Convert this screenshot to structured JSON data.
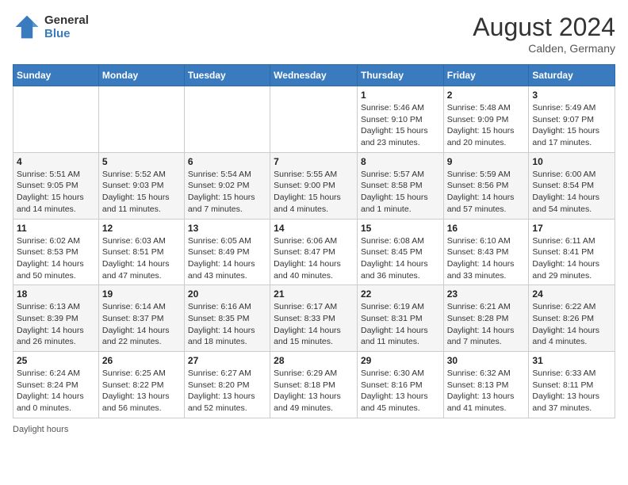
{
  "header": {
    "logo_general": "General",
    "logo_blue": "Blue",
    "month_year": "August 2024",
    "location": "Calden, Germany"
  },
  "days_of_week": [
    "Sunday",
    "Monday",
    "Tuesday",
    "Wednesday",
    "Thursday",
    "Friday",
    "Saturday"
  ],
  "weeks": [
    [
      {
        "day": "",
        "info": ""
      },
      {
        "day": "",
        "info": ""
      },
      {
        "day": "",
        "info": ""
      },
      {
        "day": "",
        "info": ""
      },
      {
        "day": "1",
        "info": "Sunrise: 5:46 AM\nSunset: 9:10 PM\nDaylight: 15 hours\nand 23 minutes."
      },
      {
        "day": "2",
        "info": "Sunrise: 5:48 AM\nSunset: 9:09 PM\nDaylight: 15 hours\nand 20 minutes."
      },
      {
        "day": "3",
        "info": "Sunrise: 5:49 AM\nSunset: 9:07 PM\nDaylight: 15 hours\nand 17 minutes."
      }
    ],
    [
      {
        "day": "4",
        "info": "Sunrise: 5:51 AM\nSunset: 9:05 PM\nDaylight: 15 hours\nand 14 minutes."
      },
      {
        "day": "5",
        "info": "Sunrise: 5:52 AM\nSunset: 9:03 PM\nDaylight: 15 hours\nand 11 minutes."
      },
      {
        "day": "6",
        "info": "Sunrise: 5:54 AM\nSunset: 9:02 PM\nDaylight: 15 hours\nand 7 minutes."
      },
      {
        "day": "7",
        "info": "Sunrise: 5:55 AM\nSunset: 9:00 PM\nDaylight: 15 hours\nand 4 minutes."
      },
      {
        "day": "8",
        "info": "Sunrise: 5:57 AM\nSunset: 8:58 PM\nDaylight: 15 hours\nand 1 minute."
      },
      {
        "day": "9",
        "info": "Sunrise: 5:59 AM\nSunset: 8:56 PM\nDaylight: 14 hours\nand 57 minutes."
      },
      {
        "day": "10",
        "info": "Sunrise: 6:00 AM\nSunset: 8:54 PM\nDaylight: 14 hours\nand 54 minutes."
      }
    ],
    [
      {
        "day": "11",
        "info": "Sunrise: 6:02 AM\nSunset: 8:53 PM\nDaylight: 14 hours\nand 50 minutes."
      },
      {
        "day": "12",
        "info": "Sunrise: 6:03 AM\nSunset: 8:51 PM\nDaylight: 14 hours\nand 47 minutes."
      },
      {
        "day": "13",
        "info": "Sunrise: 6:05 AM\nSunset: 8:49 PM\nDaylight: 14 hours\nand 43 minutes."
      },
      {
        "day": "14",
        "info": "Sunrise: 6:06 AM\nSunset: 8:47 PM\nDaylight: 14 hours\nand 40 minutes."
      },
      {
        "day": "15",
        "info": "Sunrise: 6:08 AM\nSunset: 8:45 PM\nDaylight: 14 hours\nand 36 minutes."
      },
      {
        "day": "16",
        "info": "Sunrise: 6:10 AM\nSunset: 8:43 PM\nDaylight: 14 hours\nand 33 minutes."
      },
      {
        "day": "17",
        "info": "Sunrise: 6:11 AM\nSunset: 8:41 PM\nDaylight: 14 hours\nand 29 minutes."
      }
    ],
    [
      {
        "day": "18",
        "info": "Sunrise: 6:13 AM\nSunset: 8:39 PM\nDaylight: 14 hours\nand 26 minutes."
      },
      {
        "day": "19",
        "info": "Sunrise: 6:14 AM\nSunset: 8:37 PM\nDaylight: 14 hours\nand 22 minutes."
      },
      {
        "day": "20",
        "info": "Sunrise: 6:16 AM\nSunset: 8:35 PM\nDaylight: 14 hours\nand 18 minutes."
      },
      {
        "day": "21",
        "info": "Sunrise: 6:17 AM\nSunset: 8:33 PM\nDaylight: 14 hours\nand 15 minutes."
      },
      {
        "day": "22",
        "info": "Sunrise: 6:19 AM\nSunset: 8:31 PM\nDaylight: 14 hours\nand 11 minutes."
      },
      {
        "day": "23",
        "info": "Sunrise: 6:21 AM\nSunset: 8:28 PM\nDaylight: 14 hours\nand 7 minutes."
      },
      {
        "day": "24",
        "info": "Sunrise: 6:22 AM\nSunset: 8:26 PM\nDaylight: 14 hours\nand 4 minutes."
      }
    ],
    [
      {
        "day": "25",
        "info": "Sunrise: 6:24 AM\nSunset: 8:24 PM\nDaylight: 14 hours\nand 0 minutes."
      },
      {
        "day": "26",
        "info": "Sunrise: 6:25 AM\nSunset: 8:22 PM\nDaylight: 13 hours\nand 56 minutes."
      },
      {
        "day": "27",
        "info": "Sunrise: 6:27 AM\nSunset: 8:20 PM\nDaylight: 13 hours\nand 52 minutes."
      },
      {
        "day": "28",
        "info": "Sunrise: 6:29 AM\nSunset: 8:18 PM\nDaylight: 13 hours\nand 49 minutes."
      },
      {
        "day": "29",
        "info": "Sunrise: 6:30 AM\nSunset: 8:16 PM\nDaylight: 13 hours\nand 45 minutes."
      },
      {
        "day": "30",
        "info": "Sunrise: 6:32 AM\nSunset: 8:13 PM\nDaylight: 13 hours\nand 41 minutes."
      },
      {
        "day": "31",
        "info": "Sunrise: 6:33 AM\nSunset: 8:11 PM\nDaylight: 13 hours\nand 37 minutes."
      }
    ]
  ],
  "footer": {
    "note": "Daylight hours"
  }
}
